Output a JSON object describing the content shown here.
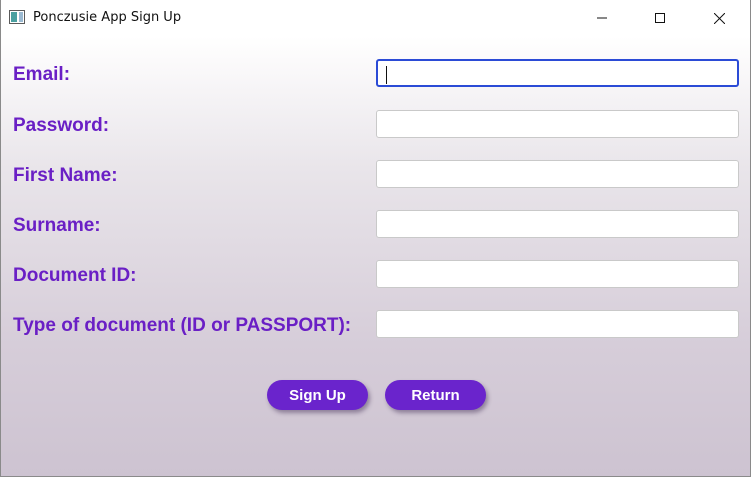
{
  "window": {
    "title": "Ponczusie App Sign Up",
    "icon": "app-window-icon",
    "controls": [
      "minimize-icon",
      "maximize-icon",
      "close-icon"
    ]
  },
  "form": {
    "fields": [
      {
        "label": "Email:",
        "value": "",
        "placeholder": "",
        "focused": true
      },
      {
        "label": "Password:",
        "value": "",
        "placeholder": ""
      },
      {
        "label": "First Name:",
        "value": "",
        "placeholder": ""
      },
      {
        "label": "Surname:",
        "value": "",
        "placeholder": ""
      },
      {
        "label": "Document ID:",
        "value": "",
        "placeholder": ""
      },
      {
        "label": "Type of document (ID or PASSPORT):",
        "value": "",
        "placeholder": ""
      }
    ],
    "buttons": {
      "sign_up": "Sign Up",
      "return": "Return"
    }
  },
  "colors": {
    "label": "#6a1fc5",
    "button": "#6a24cc",
    "focus_border": "#2b4bd6"
  }
}
